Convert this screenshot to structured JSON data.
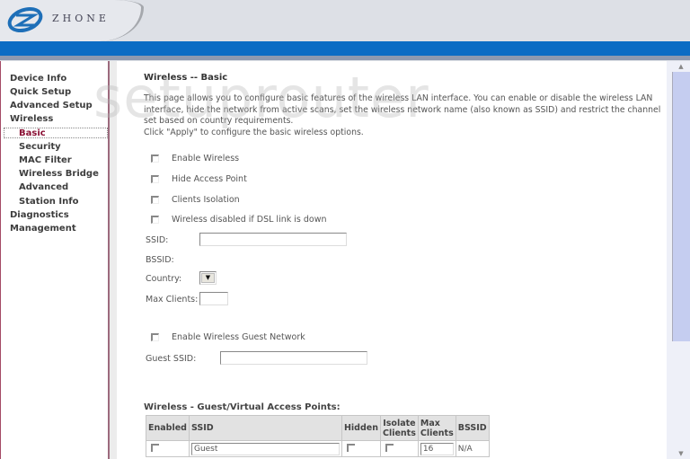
{
  "brand": {
    "name": "ZHONE",
    "accent": "#0b6cc4"
  },
  "watermark": "setuprouter",
  "sidebar": {
    "items": [
      {
        "label": "Device Info",
        "level": 0
      },
      {
        "label": "Quick Setup",
        "level": 0
      },
      {
        "label": "Advanced Setup",
        "level": 0
      },
      {
        "label": "Wireless",
        "level": 0
      },
      {
        "label": "Basic",
        "level": 1,
        "active": true
      },
      {
        "label": "Security",
        "level": 1
      },
      {
        "label": "MAC Filter",
        "level": 1
      },
      {
        "label": "Wireless Bridge",
        "level": 1
      },
      {
        "label": "Advanced",
        "level": 1
      },
      {
        "label": "Station Info",
        "level": 1
      },
      {
        "label": "Diagnostics",
        "level": 0
      },
      {
        "label": "Management",
        "level": 0
      }
    ]
  },
  "main": {
    "title": "Wireless -- Basic",
    "description": "This page allows you to configure basic features of the wireless LAN interface. You can enable or disable the wireless LAN interface, hide the network from active scans, set the wireless network name (also known as SSID) and restrict the channel set based on country requirements.",
    "description_apply": "Click \"Apply\" to configure the basic wireless options.",
    "checkboxes": [
      {
        "label": "Enable Wireless",
        "checked": false
      },
      {
        "label": "Hide Access Point",
        "checked": false
      },
      {
        "label": "Clients Isolation",
        "checked": false
      },
      {
        "label": "Wireless disabled if DSL link is down",
        "checked": false
      }
    ],
    "ssid_label": "SSID:",
    "ssid_value": "",
    "bssid_label": "BSSID:",
    "bssid_value": "",
    "country_label": "Country:",
    "country_value": "",
    "max_clients_label": "Max Clients:",
    "max_clients_value": "",
    "guest_checkbox": {
      "label": "Enable Wireless Guest Network",
      "checked": false
    },
    "guest_ssid_label": "Guest SSID:",
    "guest_ssid_value": ""
  },
  "ap_table": {
    "title": "Wireless - Guest/Virtual Access Points:",
    "headers": [
      "Enabled",
      "SSID",
      "Hidden",
      "Isolate Clients",
      "Max Clients",
      "BSSID"
    ],
    "rows": [
      {
        "enabled": false,
        "ssid": "Guest",
        "hidden": false,
        "isolate": false,
        "max_clients": "16",
        "bssid": "N/A"
      }
    ]
  }
}
